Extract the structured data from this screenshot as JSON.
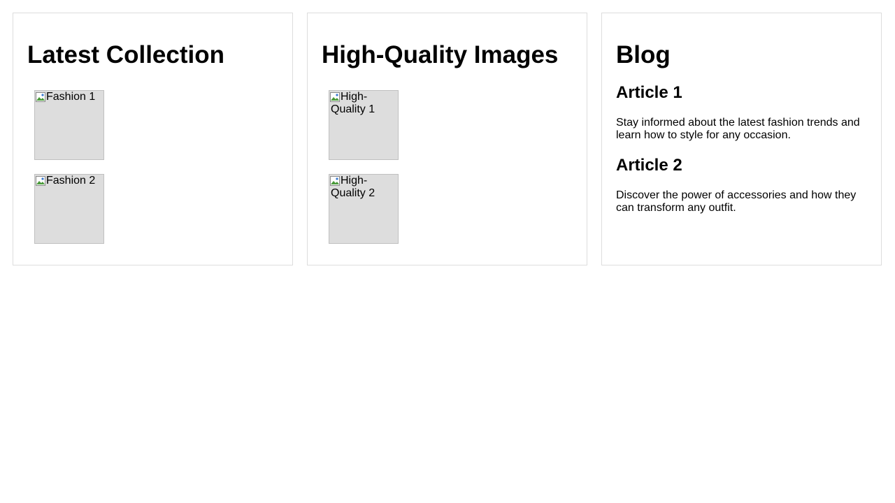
{
  "collection": {
    "title": "Latest Collection",
    "images": [
      {
        "alt": "Fashion 1"
      },
      {
        "alt": "Fashion 2"
      }
    ]
  },
  "quality": {
    "title": "High-Quality Images",
    "images": [
      {
        "alt": "High-Quality 1"
      },
      {
        "alt": "High-Quality 2"
      }
    ]
  },
  "blog": {
    "title": "Blog",
    "articles": [
      {
        "title": "Article 1",
        "text": "Stay informed about the latest fashion trends and learn how to style for any occasion."
      },
      {
        "title": "Article 2",
        "text": "Discover the power of accessories and how they can transform any outfit."
      }
    ]
  },
  "colors": {
    "card_border": "#dddddd",
    "image_placeholder": "#dddddd",
    "text": "#000000"
  },
  "icons": {
    "broken_image": "broken-image-icon"
  }
}
